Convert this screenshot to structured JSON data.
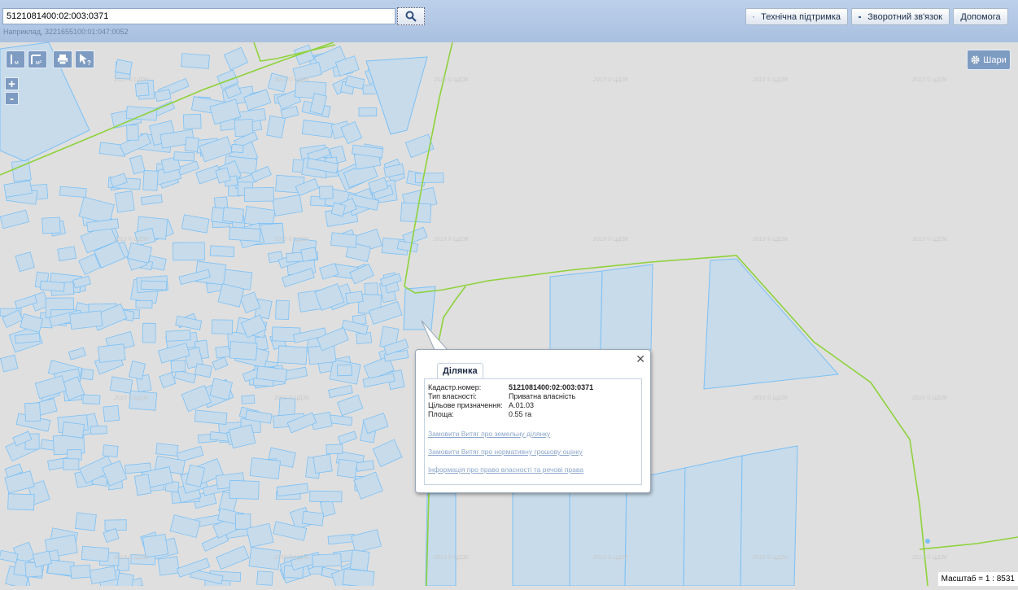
{
  "search": {
    "value": "5121081400:02:003:0371",
    "hint": "Наприклад, 3221655100:01:047:0052"
  },
  "header": {
    "support_label": "Технічна підтримка",
    "feedback_label": "Зворотний зв'язок",
    "help_label": "Допомога"
  },
  "map": {
    "layers_label": "Шари",
    "zoom_in": "+",
    "zoom_out": "-",
    "watermark": "2013 © ЦДЗК",
    "tools": [
      {
        "name": "measure-length-tool",
        "icon": "ruler-line-icon"
      },
      {
        "name": "measure-area-tool",
        "icon": "ruler-area-icon"
      },
      {
        "name": "print-tool",
        "icon": "printer-icon"
      },
      {
        "name": "identify-tool",
        "icon": "cursor-question-icon"
      }
    ],
    "colors": {
      "background": "#dfdfdf",
      "parcel_fill": "#c7dbeb",
      "parcel_stroke": "#7cc0f4",
      "boundary": "#8ed23a",
      "toolbar": "#7e9bc2"
    }
  },
  "popup": {
    "tab_label": "Ділянка",
    "rows": [
      {
        "label": "Кадастр.номер:",
        "value": "5121081400:02:003:0371"
      },
      {
        "label": "Тип власності:",
        "value": "Приватна власність"
      },
      {
        "label": "Цільове призначення:",
        "value": "A.01.03"
      },
      {
        "label": "Площа:",
        "value": "0.55 га"
      }
    ],
    "links": [
      "Замовити Витяг про земельну ділянку",
      "Замовити Витяг про нормативну грошову оцінку",
      "Інформація про право власності та речові права"
    ]
  },
  "scale": {
    "label": "Масштаб = 1 : 8531"
  }
}
